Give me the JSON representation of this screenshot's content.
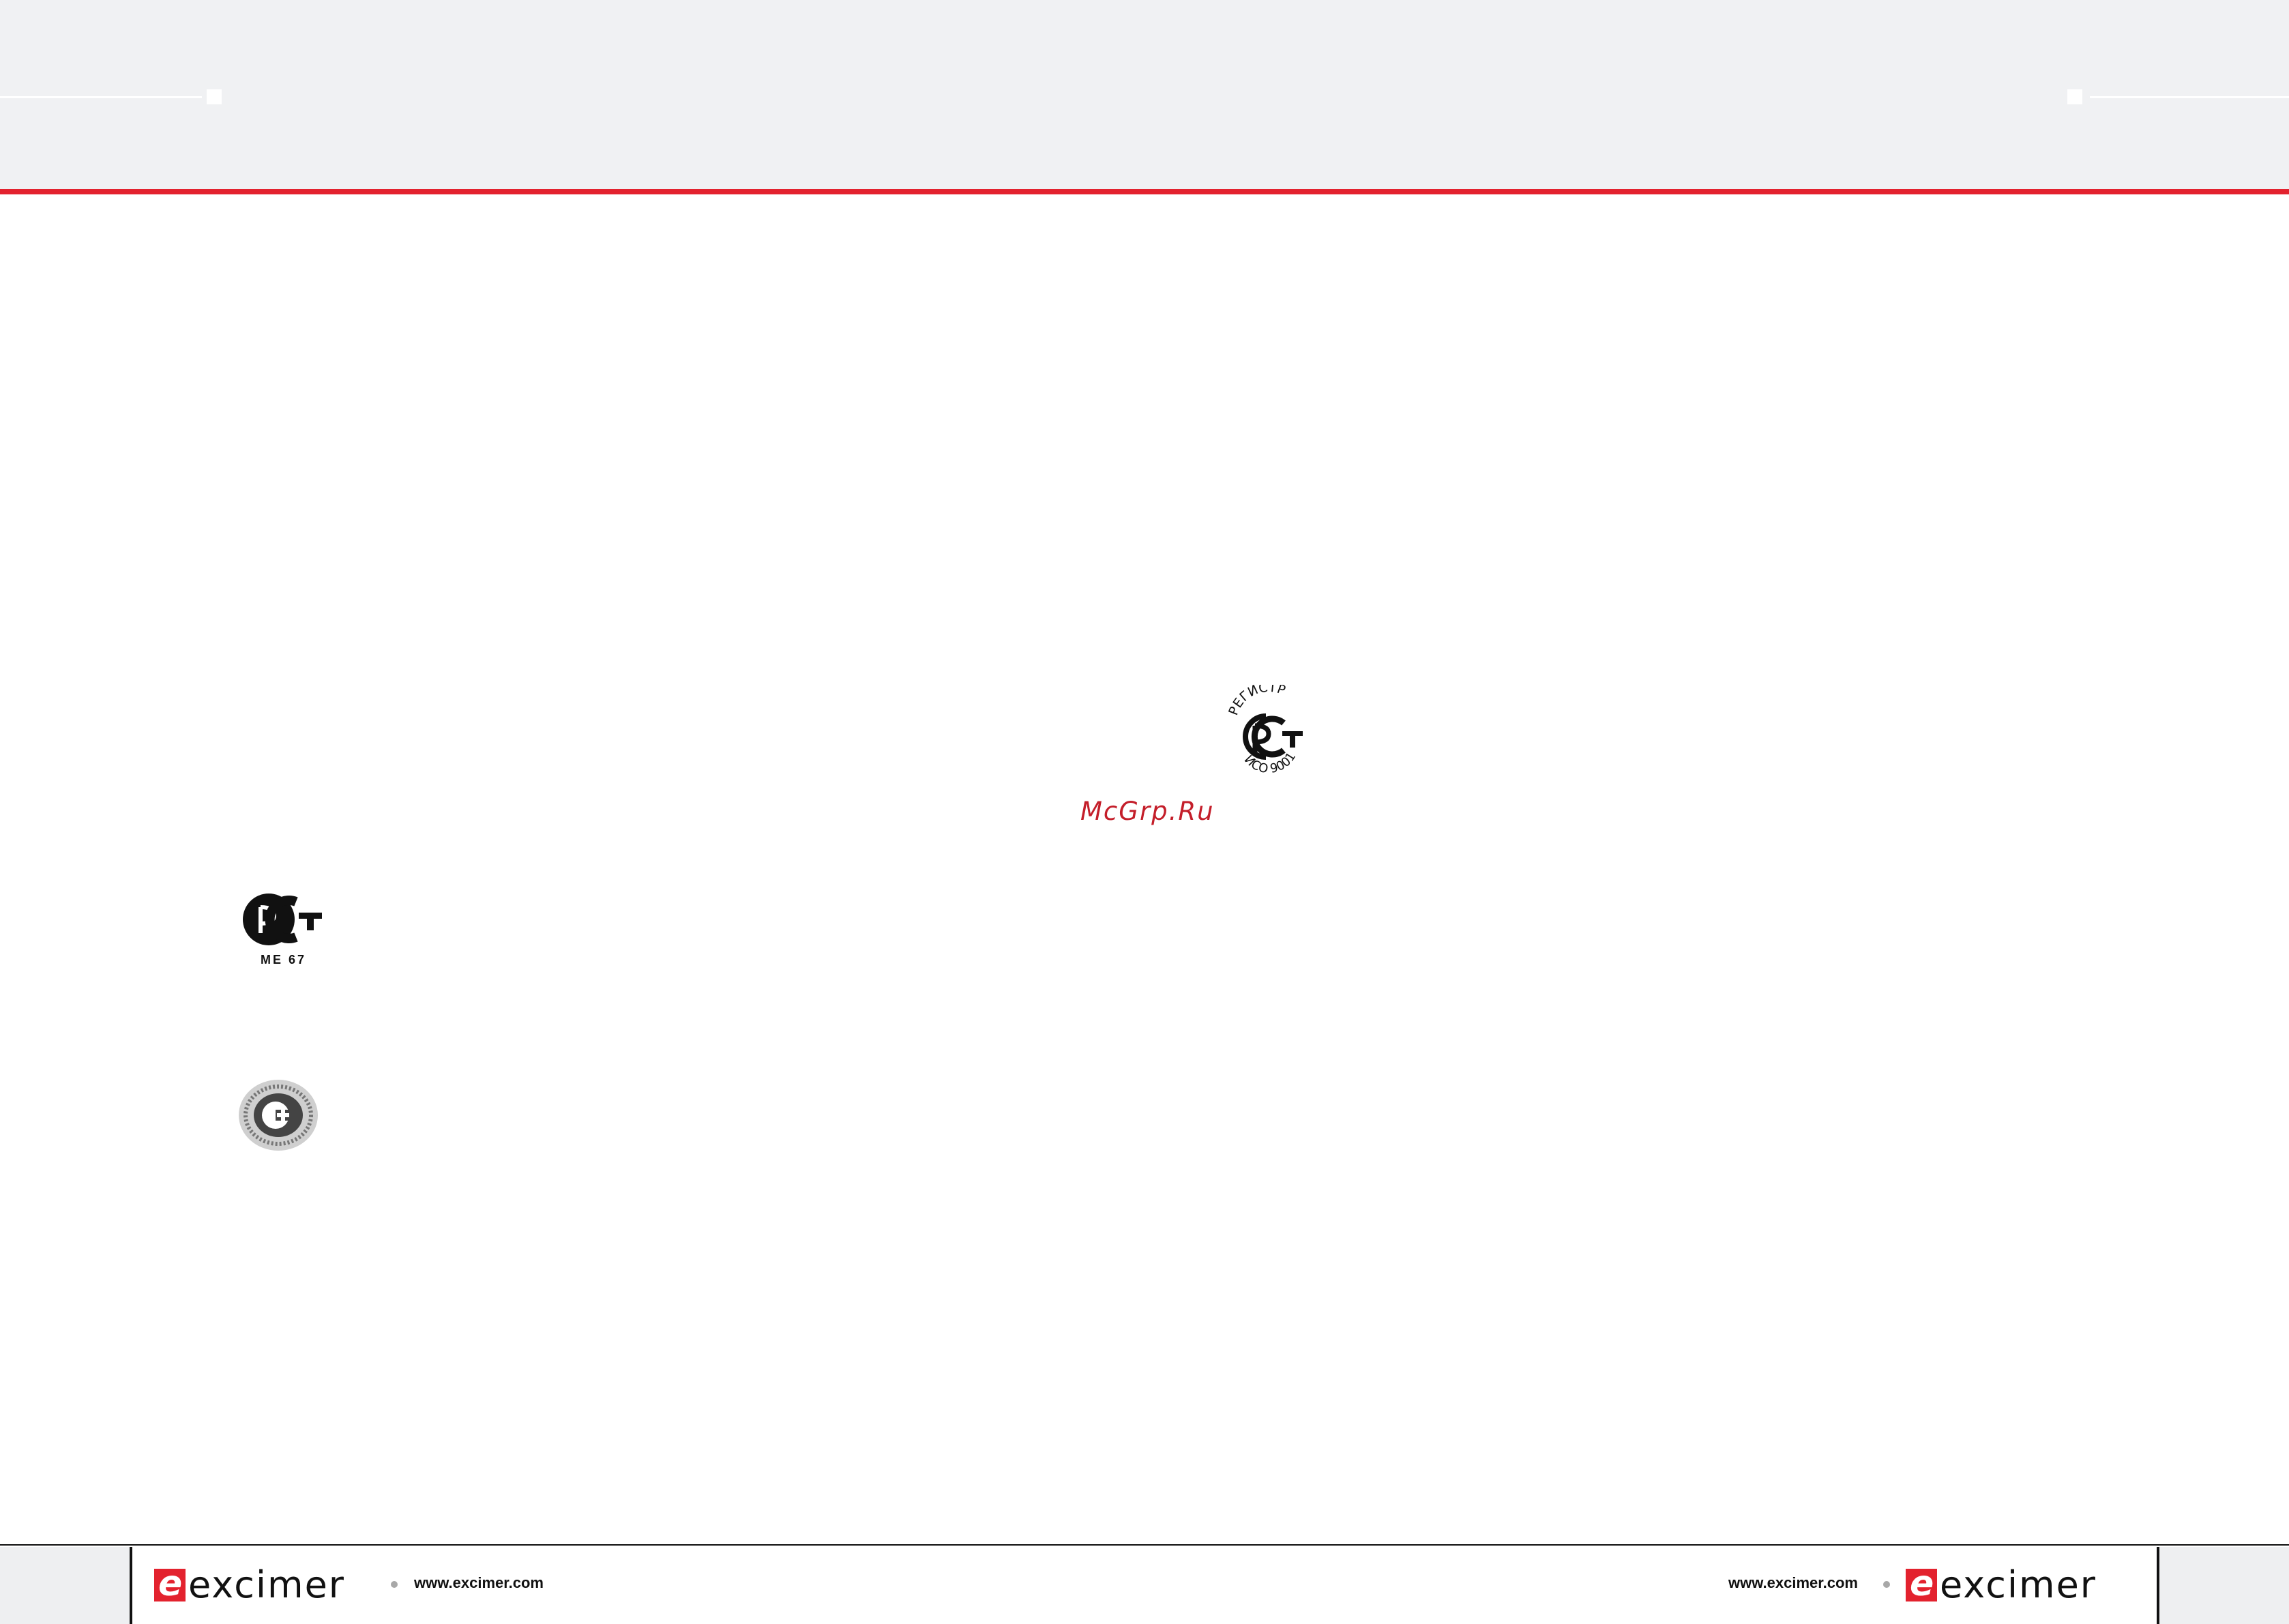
{
  "header": {
    "accent_color": "#e3222e",
    "band_color": "#f0f1f3"
  },
  "watermark": {
    "text": "McGrp.Ru",
    "color": "#c41e2a"
  },
  "marks": {
    "registry": {
      "top_text": "РЕГИСТР",
      "bottom_text": "ИСО 9001",
      "icon": "rst-registry-iso-9001-mark"
    },
    "rst": {
      "code_text": "МЕ 67",
      "icon": "rst-certification-mark"
    },
    "seal": {
      "icon": "circular-certification-seal"
    }
  },
  "footer": {
    "left": {
      "url": "www.excimer.com",
      "brand": "excimer"
    },
    "right": {
      "url": "www.excimer.com",
      "brand": "excimer"
    }
  }
}
